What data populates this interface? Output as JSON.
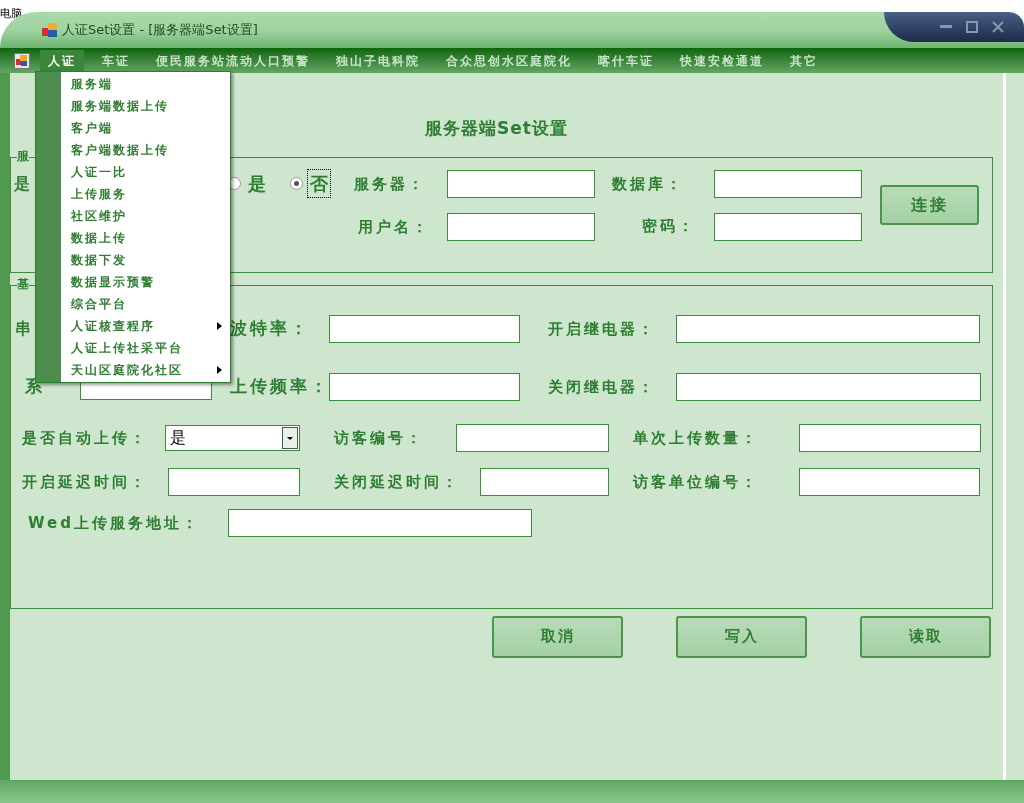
{
  "desktop_fragment": "电脑",
  "window": {
    "title": "人证Set设置 - [服务器端Set设置]"
  },
  "menubar": [
    {
      "label": "人证",
      "selected": true
    },
    {
      "label": "车证",
      "selected": false
    },
    {
      "label": "便民服务站流动人口预警",
      "selected": false
    },
    {
      "label": "独山子电科院",
      "selected": false
    },
    {
      "label": "合众思创水区庭院化",
      "selected": false
    },
    {
      "label": "喀什车证",
      "selected": false
    },
    {
      "label": "快速安检通道",
      "selected": false
    },
    {
      "label": "其它",
      "selected": false
    }
  ],
  "dropdown": [
    {
      "label": "服务端",
      "submenu": false
    },
    {
      "label": "服务端数据上传",
      "submenu": false
    },
    {
      "label": "客户端",
      "submenu": false
    },
    {
      "label": "客户端数据上传",
      "submenu": false
    },
    {
      "label": "人证一比",
      "submenu": false
    },
    {
      "label": "上传服务",
      "submenu": false
    },
    {
      "label": "社区维护",
      "submenu": false
    },
    {
      "label": "数据上传",
      "submenu": false
    },
    {
      "label": "数据下发",
      "submenu": false
    },
    {
      "label": "数据显示预警",
      "submenu": false
    },
    {
      "label": "综合平台",
      "submenu": false
    },
    {
      "label": "人证核查程序",
      "submenu": true
    },
    {
      "label": "人证上传社采平台",
      "submenu": false
    },
    {
      "label": "天山区庭院化社区",
      "submenu": true
    }
  ],
  "form_title": "服务器端Set设置",
  "server_group": {
    "legend": "服",
    "mode_label": "是",
    "mode_options": [
      {
        "label": "是",
        "selected": false
      },
      {
        "label": "否",
        "selected": true
      }
    ],
    "server_label": "服务器：",
    "database_label": "数据库：",
    "user_label": "用户名：",
    "password_label": "密码：",
    "connect": "连接"
  },
  "basic_group": {
    "legend": "基",
    "serial_label": "串",
    "baud_label": "波特率：",
    "relay_on_label": "开启继电器：",
    "system_label": "系",
    "upload_freq_label": "上传频率：",
    "relay_off_label": "关闭继电器：",
    "auto_upload_label": "是否自动上传：",
    "auto_upload_value": "是",
    "visitor_no_label": "访客编号：",
    "batch_label": "单次上传数量：",
    "open_delay_label": "开启延迟时间：",
    "close_delay_label": "关闭延迟时间：",
    "visitor_unit_label": "访客单位编号：",
    "web_url_label": "Wed上传服务地址："
  },
  "buttons": [
    "取消",
    "写入",
    "读取"
  ]
}
